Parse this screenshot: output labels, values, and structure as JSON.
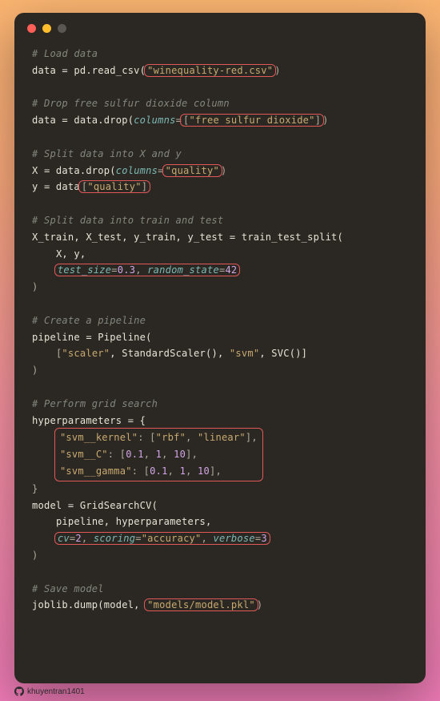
{
  "footer": {
    "username": "khuyentran1401"
  },
  "code": {
    "c1": "# Load data",
    "l1a": "data = pd.read_csv(",
    "l1b": "\"winequality-red.csv\"",
    "l1c": ")",
    "c2": "# Drop free sulfur dioxide column",
    "l2a": "data = data.drop(",
    "l2b": "columns",
    "l2c": "=",
    "l2d": "[\"free sulfur dioxide\"]",
    "l2e": ")",
    "c3": "# Split data into X and y",
    "l3a": "X = data.drop(",
    "l3b": "columns",
    "l3c": "=",
    "l3d": "\"quality\"",
    "l3e": ")",
    "l4a": "y = data",
    "l4b": "[\"quality\"]",
    "c4": "# Split data into train and test",
    "l5": "X_train, X_test, y_train, y_test = train_test_split(",
    "l6": "    X, y,",
    "l7a": "test_size",
    "l7b": "=",
    "l7c": "0.3",
    "l7d": ", ",
    "l7e": "random_state",
    "l7f": "=",
    "l7g": "42",
    "l8": ")",
    "c5": "# Create a pipeline",
    "l9": "pipeline = Pipeline(",
    "l10a": "    [",
    "l10b": "\"scaler\"",
    "l10c": ", StandardScaler(), ",
    "l10d": "\"svm\"",
    "l10e": ", SVC()]",
    "l11": ")",
    "c6": "# Perform grid search",
    "l12": "hyperparameters = {",
    "l13a": "\"svm__kernel\"",
    "l13b": ": [",
    "l13c": "\"rbf\"",
    "l13d": ", ",
    "l13e": "\"linear\"",
    "l13f": "],",
    "l14a": "\"svm__C\"",
    "l14b": ": [",
    "l14c": "0.1",
    "l14d": ", ",
    "l14e": "1",
    "l14f": ", ",
    "l14g": "10",
    "l14h": "],",
    "l15a": "\"svm__gamma\"",
    "l15b": ": [",
    "l15c": "0.1",
    "l15d": ", ",
    "l15e": "1",
    "l15f": ", ",
    "l15g": "10",
    "l15h": "],",
    "l16": "}",
    "l17": "model = GridSearchCV(",
    "l18": "    pipeline, hyperparameters,",
    "l19a": "cv",
    "l19b": "=",
    "l19c": "2",
    "l19d": ", ",
    "l19e": "scoring",
    "l19f": "=",
    "l19g": "\"accuracy\"",
    "l19h": ", ",
    "l19i": "verbose",
    "l19j": "=",
    "l19k": "3",
    "l20": ")",
    "c7": "# Save model",
    "l21a": "joblib.dump(model, ",
    "l21b": "\"models/model.pkl\"",
    "l21c": ")"
  }
}
